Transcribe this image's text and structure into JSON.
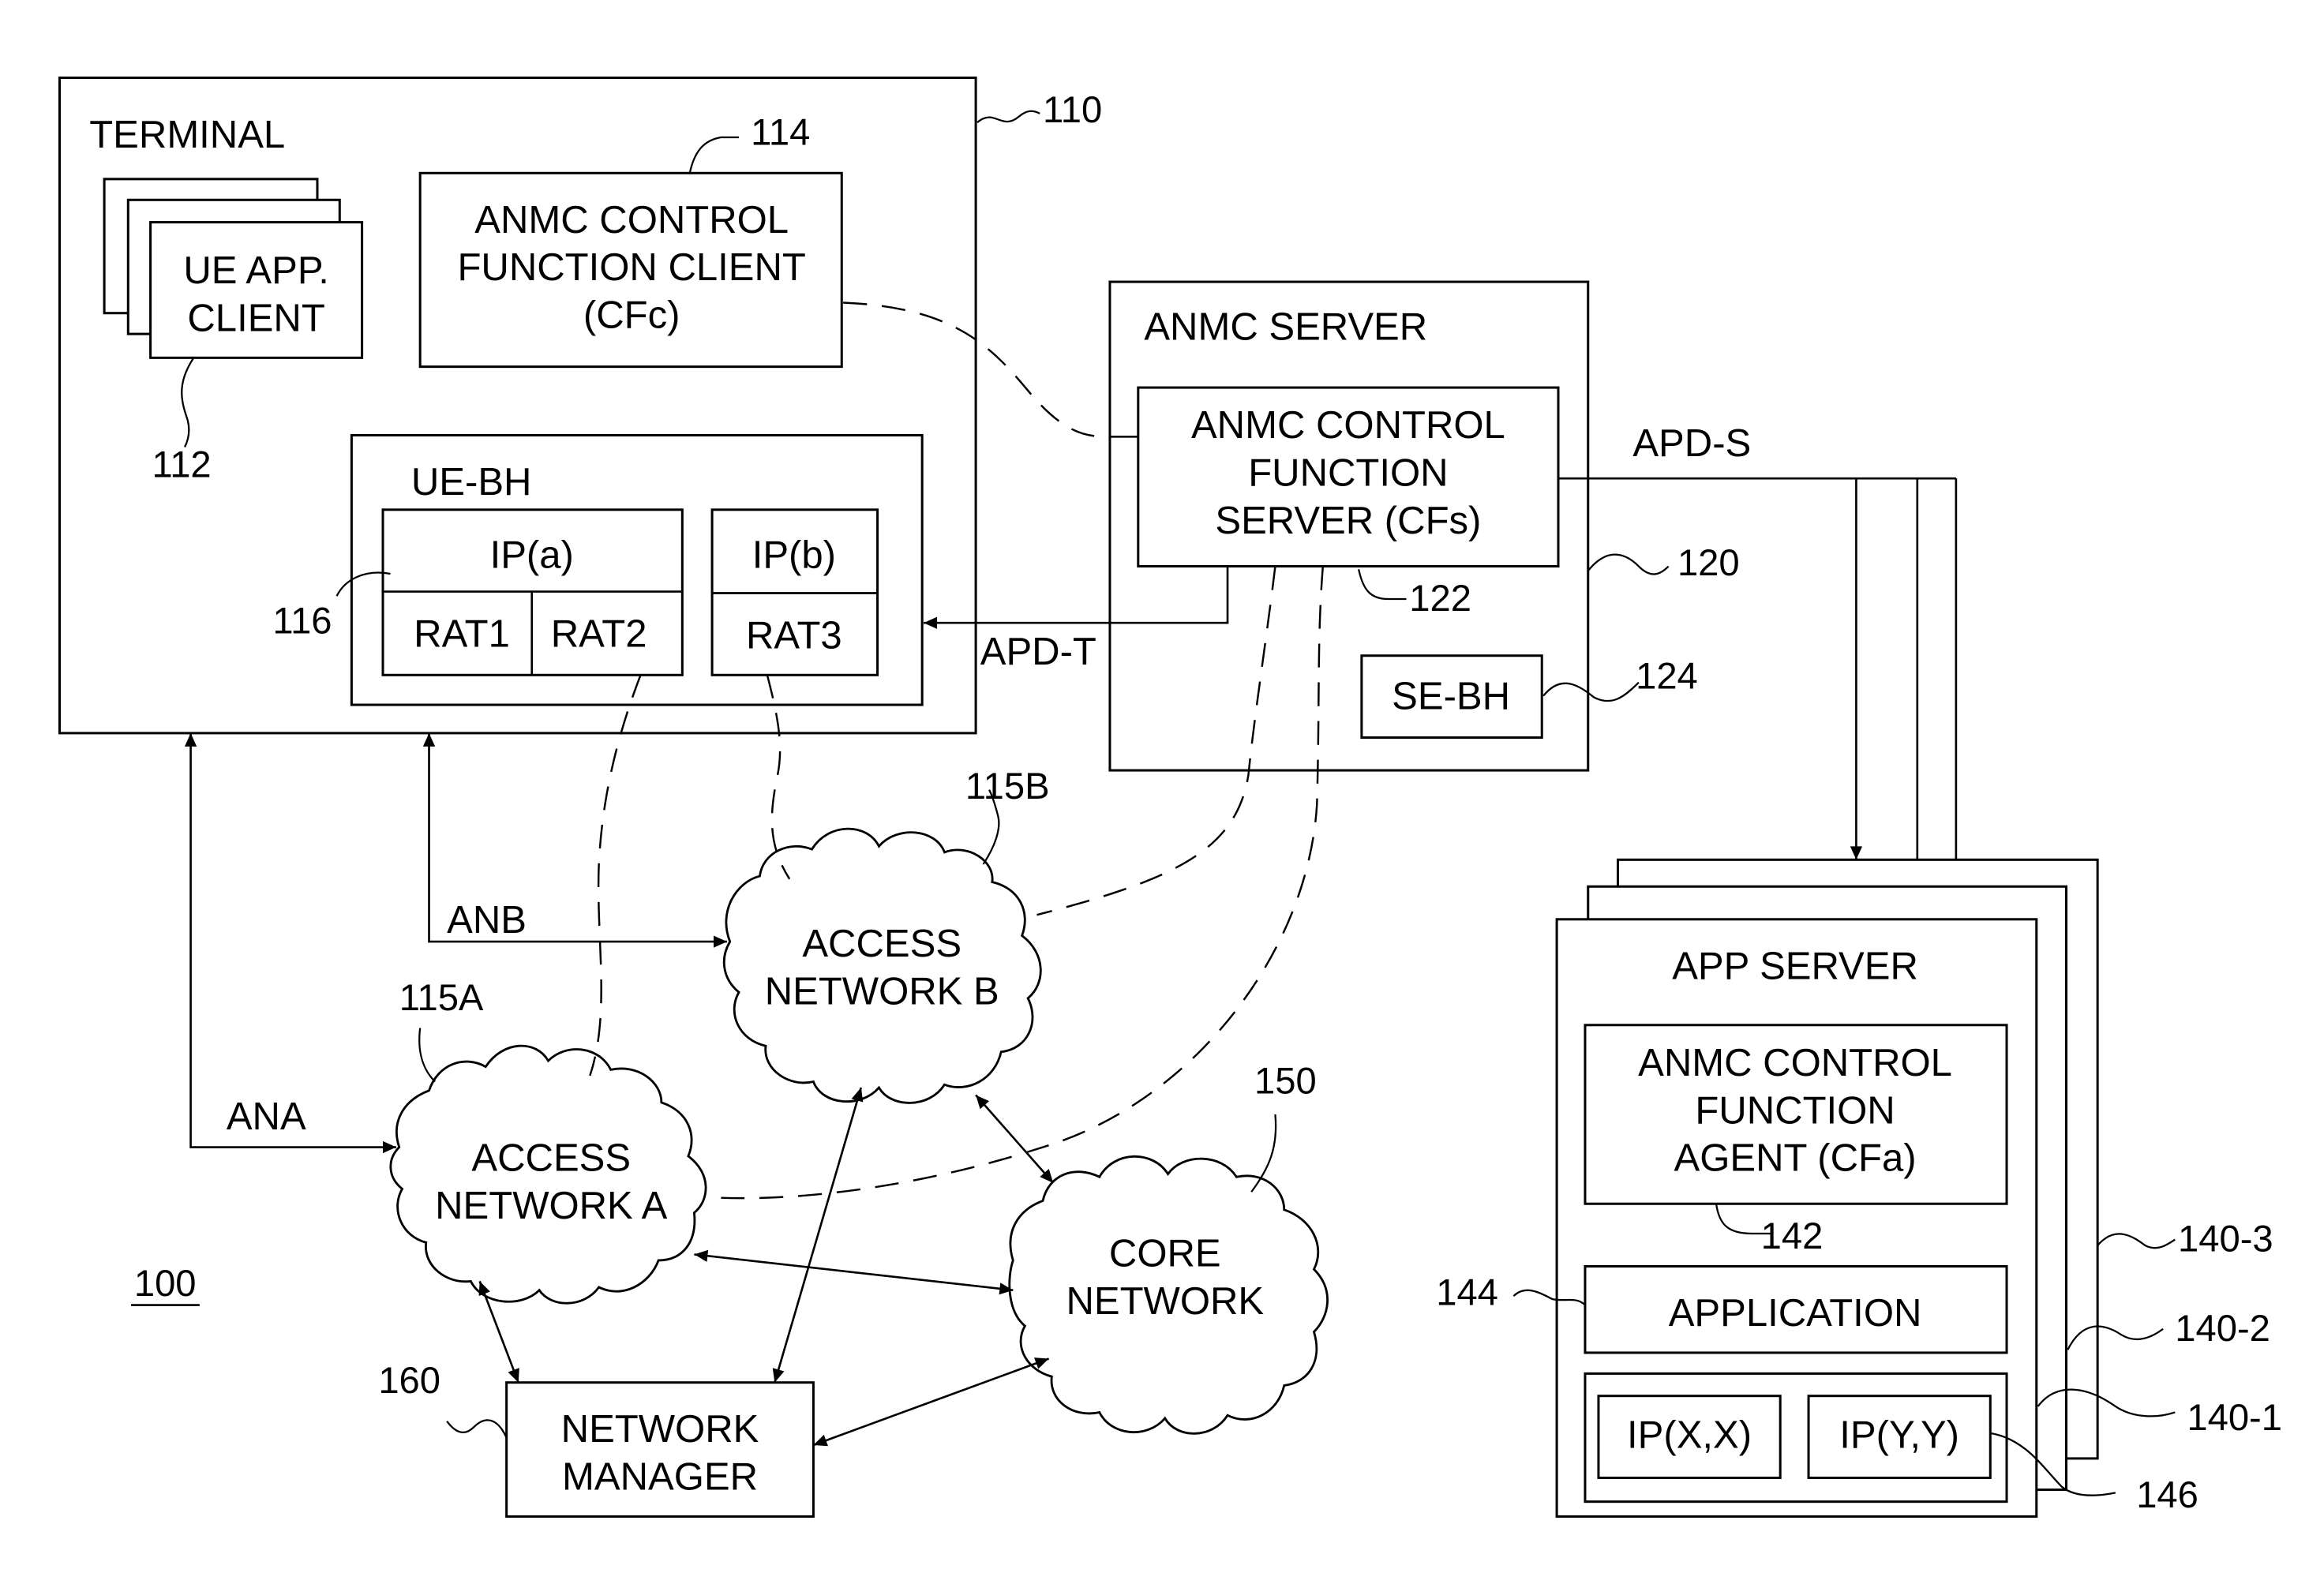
{
  "figure_label": "100",
  "colors": {
    "ink": "#000000",
    "paper": "#ffffff"
  },
  "terminal": {
    "title": "TERMINAL",
    "ref": "110",
    "ue_app_client": {
      "lines": [
        "UE APP.",
        "CLIENT"
      ],
      "ref": "112"
    },
    "cfc": {
      "lines": [
        "ANMC CONTROL",
        "FUNCTION CLIENT",
        "(CFc)"
      ],
      "ref": "114"
    },
    "ue_bh": {
      "title": "UE-BH",
      "ref": "116",
      "ip_a": {
        "label": "IP(a)",
        "rats": [
          "RAT1",
          "RAT2"
        ]
      },
      "ip_b": {
        "label": "IP(b)",
        "rats": [
          "RAT3"
        ]
      }
    }
  },
  "anmc_server": {
    "title": "ANMC SERVER",
    "ref": "120",
    "cfs": {
      "lines": [
        "ANMC CONTROL",
        "FUNCTION",
        "SERVER (CFs)"
      ],
      "ref": "122"
    },
    "se_bh": {
      "label": "SE-BH",
      "ref": "124"
    }
  },
  "links": {
    "apd_t": "APD-T",
    "apd_s": "APD-S",
    "ana": "ANA",
    "anb": "ANB"
  },
  "networks": {
    "access_a": {
      "lines": [
        "ACCESS",
        "NETWORK A"
      ],
      "ref": "115A"
    },
    "access_b": {
      "lines": [
        "ACCESS",
        "NETWORK B"
      ],
      "ref": "115B"
    },
    "core": {
      "lines": [
        "CORE",
        "NETWORK"
      ],
      "ref": "150"
    }
  },
  "network_manager": {
    "lines": [
      "NETWORK",
      "MANAGER"
    ],
    "ref": "160"
  },
  "app_server": {
    "title": "APP SERVER",
    "refs": [
      "140-1",
      "140-2",
      "140-3"
    ],
    "cfa": {
      "lines": [
        "ANMC CONTROL",
        "FUNCTION",
        "AGENT (CFa)"
      ],
      "ref": "142"
    },
    "application": {
      "label": "APPLICATION",
      "ref": "144"
    },
    "ip_group": {
      "items": [
        "IP(X,X)",
        "IP(Y,Y)"
      ],
      "ref": "146"
    }
  }
}
